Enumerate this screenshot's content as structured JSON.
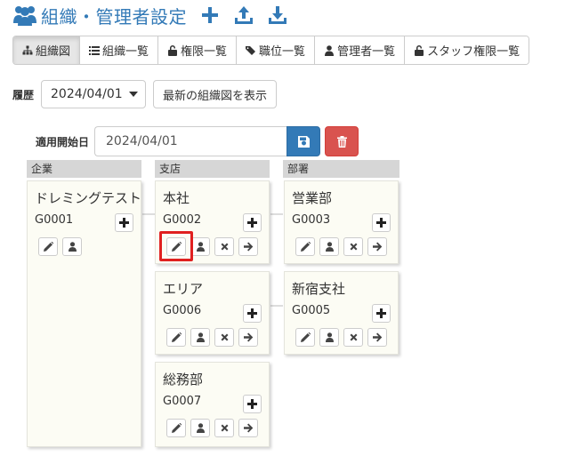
{
  "header": {
    "title": "組織・管理者設定",
    "accent_color": "#337ab7",
    "icons": [
      "users-icon",
      "plus-icon",
      "upload-icon",
      "download-icon"
    ]
  },
  "tabs": [
    {
      "label": "組織図",
      "icon": "sitemap-icon",
      "active": true
    },
    {
      "label": "組織一覧",
      "icon": "list-icon",
      "active": false
    },
    {
      "label": "権限一覧",
      "icon": "unlock-icon",
      "active": false
    },
    {
      "label": "職位一覧",
      "icon": "tags-icon",
      "active": false
    },
    {
      "label": "管理者一覧",
      "icon": "user-icon",
      "active": false
    },
    {
      "label": "スタッフ権限一覧",
      "icon": "unlock-icon",
      "active": false
    }
  ],
  "history": {
    "label": "履歴",
    "selected": "2024/04/01",
    "latest_button": "最新の組織図を表示"
  },
  "start": {
    "label": "適用開始日",
    "value": "2024/04/01",
    "save_color": "#337ab7",
    "delete_color": "#d9534f"
  },
  "columns": [
    "企業",
    "支店",
    "部署"
  ],
  "nodes": {
    "company": {
      "name": "ドレミングテスト",
      "code": "G0001"
    },
    "honsha": {
      "name": "本社",
      "code": "G0002"
    },
    "area": {
      "name": "エリア",
      "code": "G0006"
    },
    "soumu": {
      "name": "総務部",
      "code": "G0007"
    },
    "eigyo": {
      "name": "営業部",
      "code": "G0003"
    },
    "shinjuku": {
      "name": "新宿支社",
      "code": "G0005"
    }
  },
  "node_actions": [
    "pencil-icon",
    "user-icon",
    "remove-icon",
    "arrow-right-icon"
  ]
}
